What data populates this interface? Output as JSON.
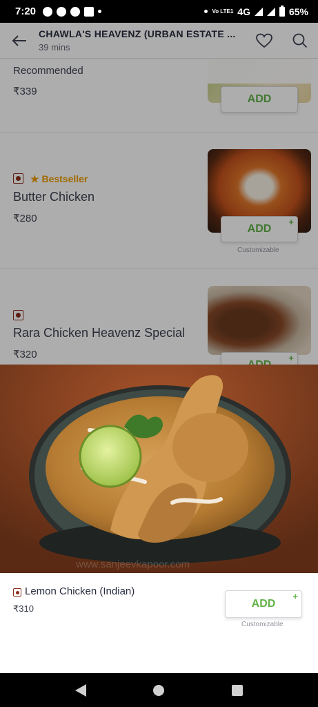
{
  "status_bar": {
    "time": "7:20",
    "network": "4G",
    "volte": "Vo LTE1",
    "battery": "65%"
  },
  "header": {
    "title": "CHAWLA'S HEAVENZ (URBAN ESTATE ...",
    "eta": "39 mins",
    "back_icon": "back-arrow-icon",
    "fav_icon": "heart-icon",
    "search_icon": "search-icon"
  },
  "section": {
    "title": "Recommended"
  },
  "items": [
    {
      "name": "",
      "price": "₹339",
      "add_label": "ADD"
    },
    {
      "bestseller": "Bestseller",
      "name": "Butter Chicken",
      "price": "₹280",
      "add_label": "ADD",
      "plus": "+",
      "customizable": "Customizable"
    },
    {
      "name": "Rara Chicken Heavenz Special",
      "price": "₹320",
      "add_label": "ADD",
      "plus": "+"
    }
  ],
  "hero": {
    "watermark": "www.sanjeevkapoor.com"
  },
  "sheet": {
    "name": "Lemon Chicken (Indian)",
    "price": "₹310",
    "add_label": "ADD",
    "plus": "+",
    "customizable": "Customizable"
  },
  "colors": {
    "accent_green": "#60b246",
    "bestseller": "#ee9c00",
    "veg_brown": "#8b2d1a"
  }
}
